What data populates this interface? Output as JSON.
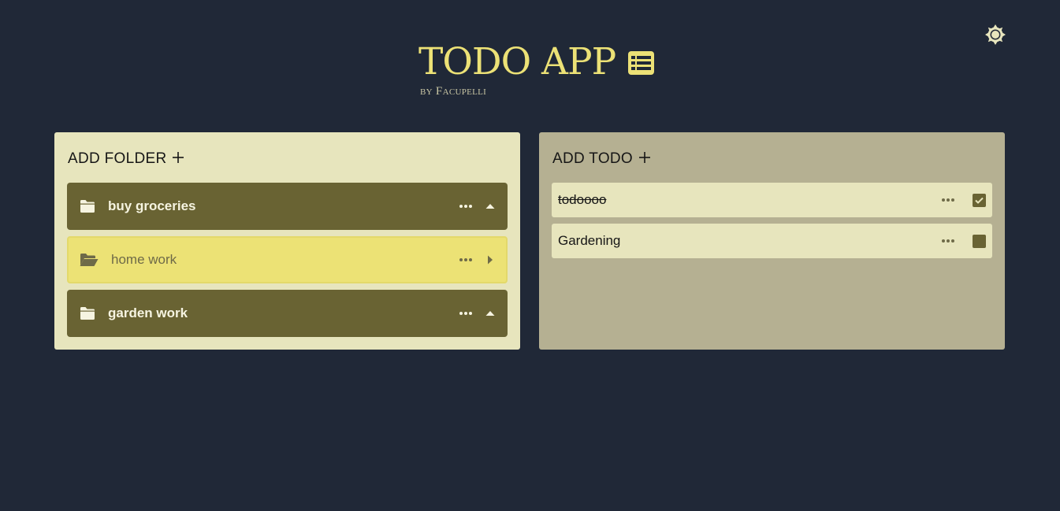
{
  "header": {
    "title": "TODO APP",
    "byline": "by Facupelli"
  },
  "colors": {
    "background": "#202837",
    "accent_yellow": "#ece176",
    "folder_panel": "#e7e5bd",
    "todo_panel": "#b5b092",
    "folder_item": "#696333",
    "folder_active": "#ece275"
  },
  "folders_panel": {
    "add_label": "ADD FOLDER",
    "items": [
      {
        "label": "buy groceries",
        "icon": "folder-icon",
        "state": "expanded"
      },
      {
        "label": "home work",
        "icon": "folder-open-icon",
        "state": "selected"
      },
      {
        "label": "garden work",
        "icon": "folder-icon",
        "state": "expanded"
      }
    ]
  },
  "todos_panel": {
    "add_label": "ADD TODO",
    "items": [
      {
        "label": "todoooo",
        "done": true
      },
      {
        "label": "Gardening",
        "done": false
      }
    ]
  },
  "icons": {
    "theme_toggle": "sun-icon",
    "title": "list-icon"
  }
}
